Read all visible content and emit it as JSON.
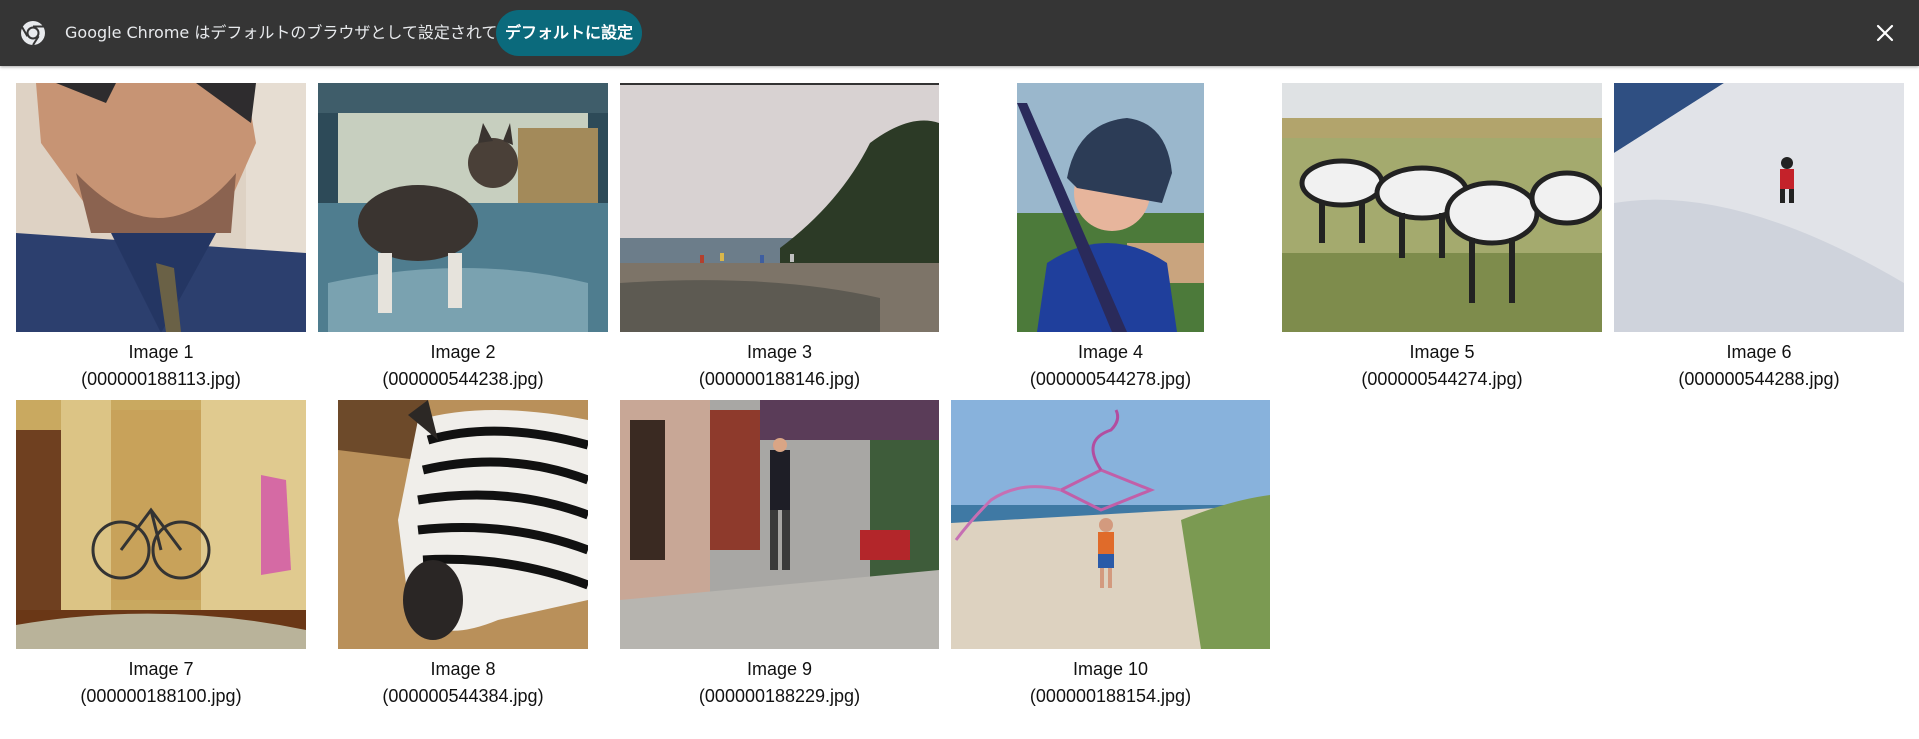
{
  "infobar": {
    "message": "Google Chrome はデフォルトのブラウザとして設定されていません",
    "button_label": "デフォルトに設定",
    "colors": {
      "background": "#353535",
      "button": "#0b6a7c",
      "text": "#e8eaed"
    },
    "icons": {
      "logo": "chrome-logo-icon",
      "close": "close-icon"
    }
  },
  "gallery": {
    "images": [
      {
        "title": "Image 1",
        "file": "(000000188113.jpg)"
      },
      {
        "title": "Image 2",
        "file": "(000000544238.jpg)"
      },
      {
        "title": "Image 3",
        "file": "(000000188146.jpg)"
      },
      {
        "title": "Image 4",
        "file": "(000000544278.jpg)"
      },
      {
        "title": "Image 5",
        "file": "(000000544274.jpg)"
      },
      {
        "title": "Image 6",
        "file": "(000000544288.jpg)"
      },
      {
        "title": "Image 7",
        "file": "(000000188100.jpg)"
      },
      {
        "title": "Image 8",
        "file": "(000000544384.jpg)"
      },
      {
        "title": "Image 9",
        "file": "(000000188229.jpg)"
      },
      {
        "title": "Image 10",
        "file": "(000000188154.jpg)"
      }
    ]
  }
}
